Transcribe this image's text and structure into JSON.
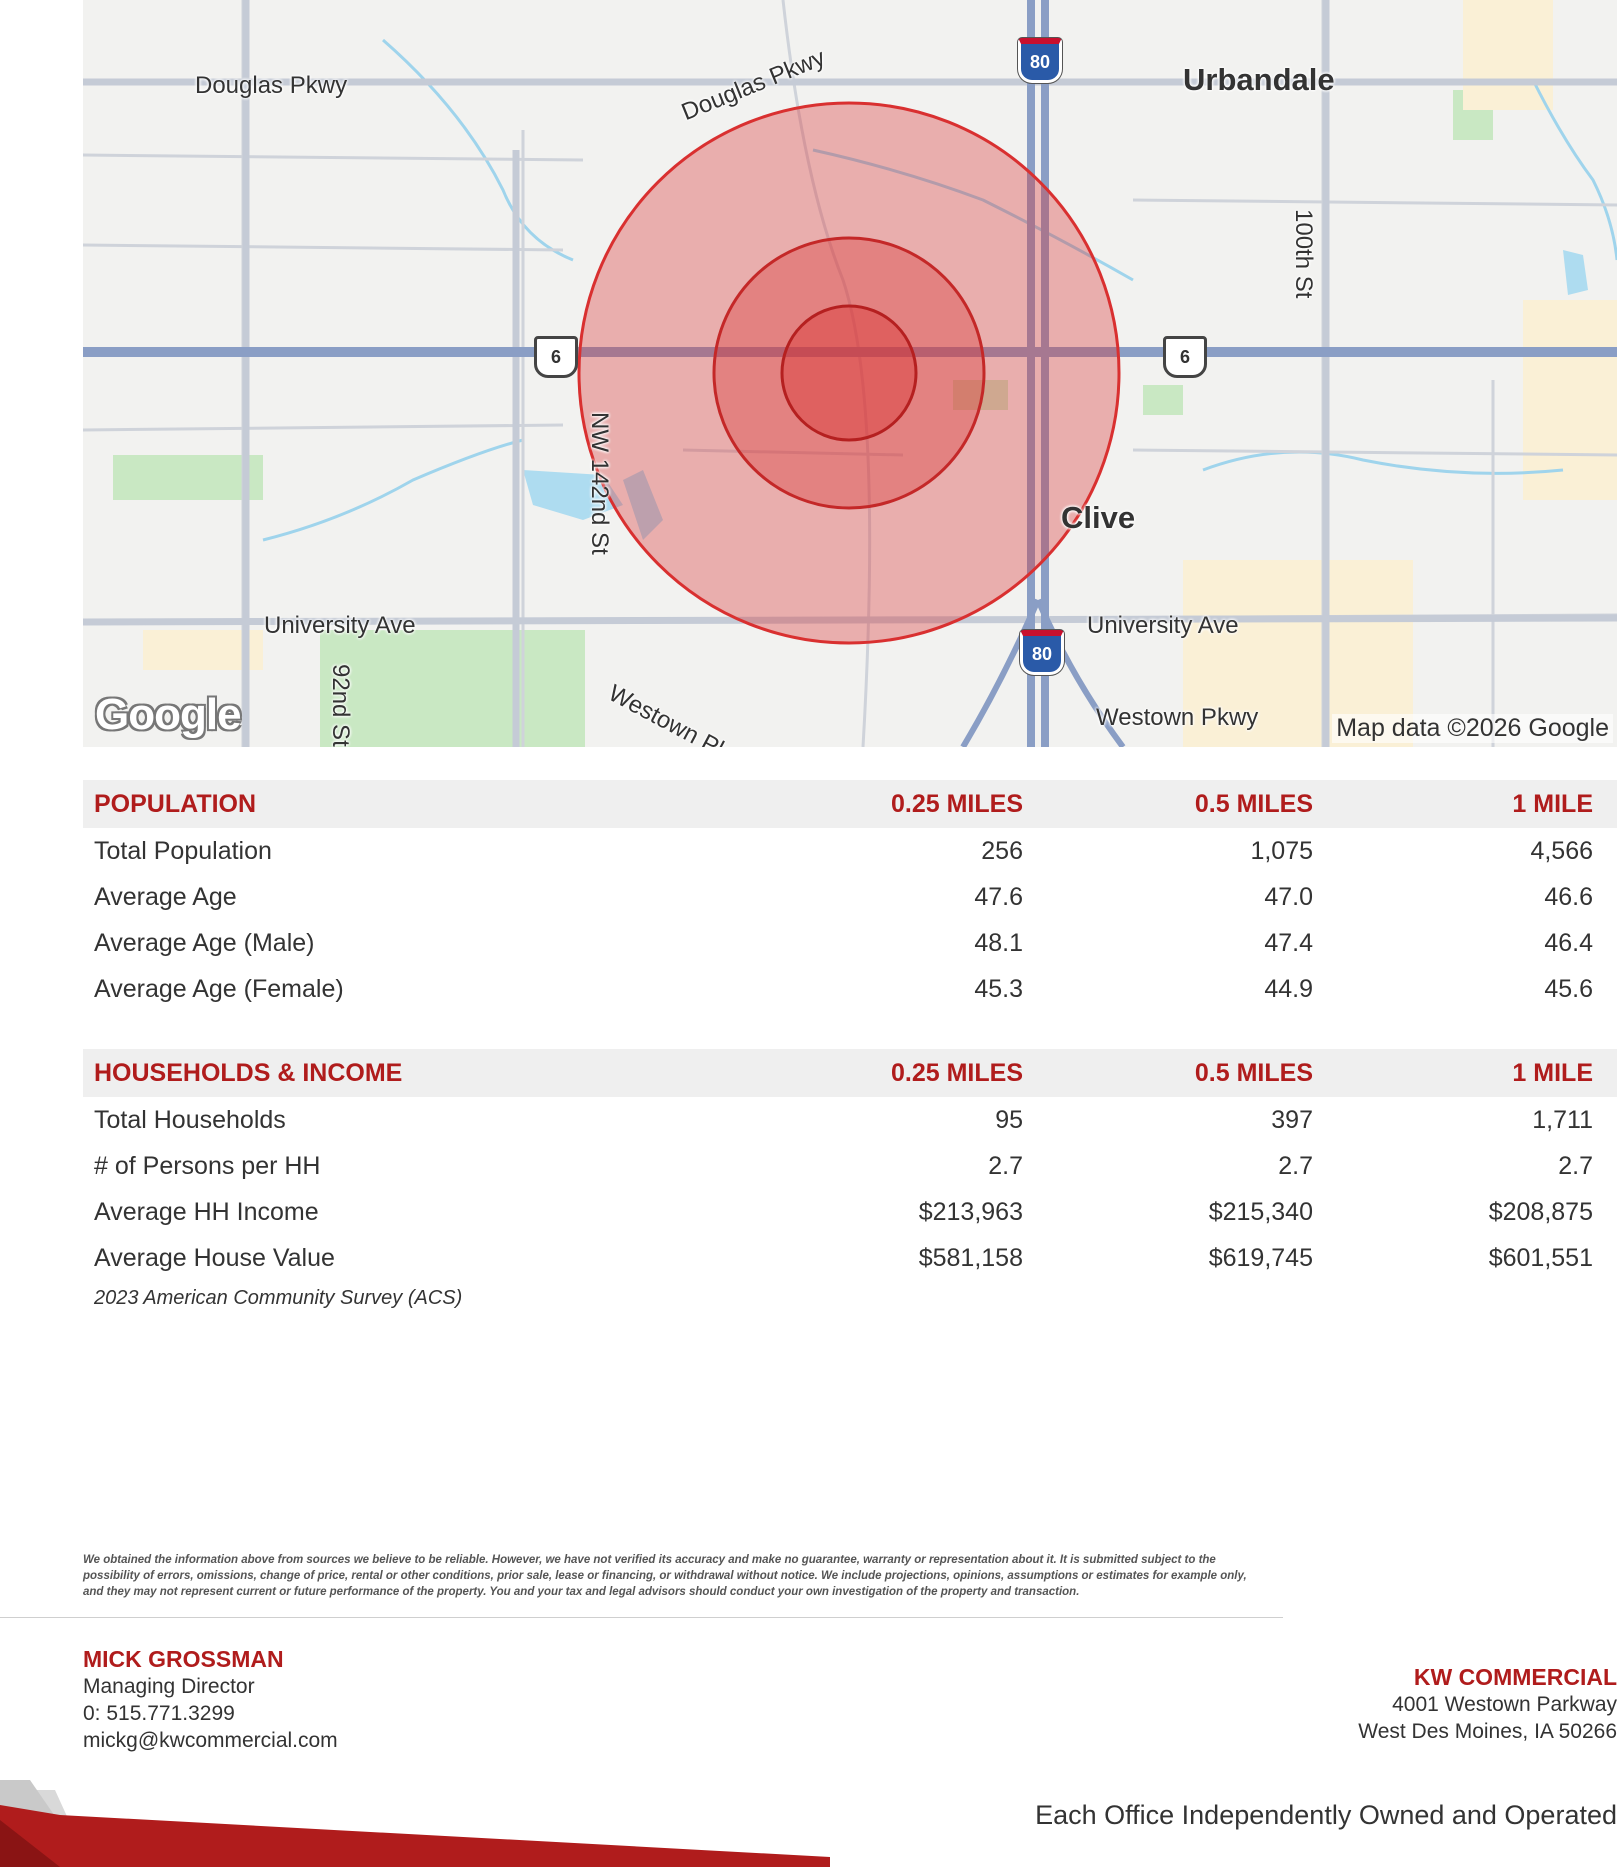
{
  "map": {
    "towns": [
      "Urbandale",
      "Clive"
    ],
    "roads": [
      "Douglas Pkwy",
      "Douglas Pkwy",
      "100th St",
      "NW 142nd St",
      "University Ave",
      "University Ave",
      "92nd St",
      "Westown Pkwy",
      "Westown Pkwy"
    ],
    "route_shields": [
      "80",
      "80",
      "6",
      "6"
    ],
    "logo_text": "Google",
    "attribution": "Map data ©2026 Google",
    "ring_color": "#d93030",
    "road_color": "#8a9ec5"
  },
  "population": {
    "headers": [
      "POPULATION",
      "0.25 MILES",
      "0.5 MILES",
      "1 MILE"
    ],
    "rows": [
      {
        "label": "Total Population",
        "values": [
          "256",
          "1,075",
          "4,566"
        ]
      },
      {
        "label": "Average Age",
        "values": [
          "47.6",
          "47.0",
          "46.6"
        ]
      },
      {
        "label": "Average Age (Male)",
        "values": [
          "48.1",
          "47.4",
          "46.4"
        ]
      },
      {
        "label": "Average Age (Female)",
        "values": [
          "45.3",
          "44.9",
          "45.6"
        ]
      }
    ]
  },
  "households": {
    "headers": [
      "HOUSEHOLDS & INCOME",
      "0.25 MILES",
      "0.5 MILES",
      "1 MILE"
    ],
    "rows": [
      {
        "label": "Total Households",
        "values": [
          "95",
          "397",
          "1,711"
        ]
      },
      {
        "label": "# of Persons per HH",
        "values": [
          "2.7",
          "2.7",
          "2.7"
        ]
      },
      {
        "label": "Average HH Income",
        "values": [
          "$213,963",
          "$215,340",
          "$208,875"
        ]
      },
      {
        "label": "Average House Value",
        "values": [
          "$581,158",
          "$619,745",
          "$601,551"
        ]
      }
    ]
  },
  "source_note": "2023 American Community Survey (ACS)",
  "disclaimer": "We obtained the information above from sources we believe to be reliable. However, we have not verified its accuracy and make no guarantee, warranty or representation about it. It is submitted subject to the possibility of errors, omissions, change of price, rental or other conditions, prior sale, lease or financing, or withdrawal without notice. We include projections, opinions, assumptions or estimates for example only, and they may not represent current or future performance of the property. You and your tax and legal advisors should conduct your own investigation of the property and transaction.",
  "agent": {
    "name": "MICK GROSSMAN",
    "title": "Managing Director",
    "phone": "0: 515.771.3299",
    "email": "mickg@kwcommercial.com"
  },
  "office": {
    "company": "KW COMMERCIAL",
    "address1": "4001 Westown Parkway",
    "address2": "West Des Moines, IA 50266"
  },
  "tagline": "Each Office Independently Owned and Operated",
  "colors": {
    "accent": "#b01c1c",
    "header_bg": "#efefef"
  }
}
